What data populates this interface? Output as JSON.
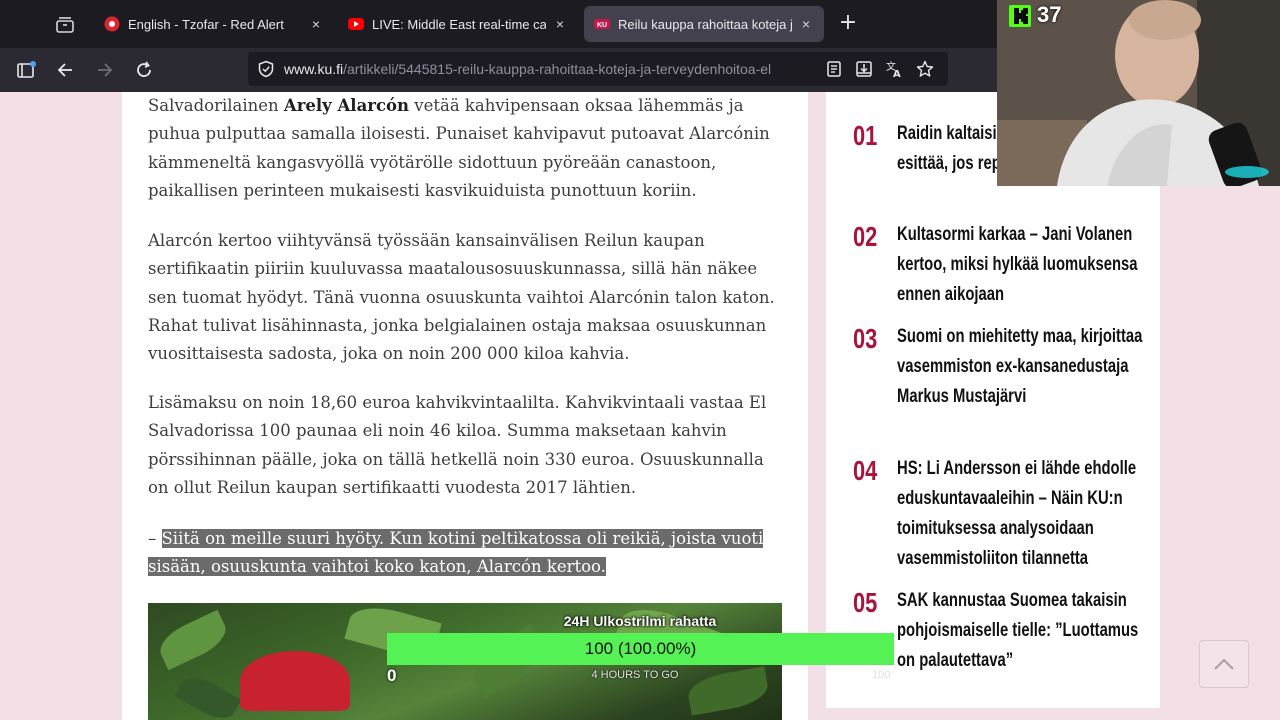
{
  "browser": {
    "tabs": [
      {
        "title": "English - Tzofar - Red Alert",
        "close": "×"
      },
      {
        "title": "LIVE: Middle East real-time cam",
        "close": "×"
      },
      {
        "title": "Reilu kauppa rahoittaa koteja ja",
        "close": "×"
      }
    ],
    "new_tab": "+",
    "url_host": "www.ku.fi",
    "url_path": "/artikkeli/5445815-reilu-kauppa-rahoittaa-koteja-ja-terveydenhoitoa-el"
  },
  "article": {
    "p1_before": "Salvadorilainen ",
    "p1_name": "Arely Alarcón",
    "p1_after": " vetää kahvipensaan oksaa lähemmäs ja puhua pulputtaa samalla iloisesti. Punaiset kahvipavut putoavat Alarcónin kämmeneltä kangasvyöllä vyötärölle sidottuun pyöreään canastoon, paikallisen perinteen mukaisesti kasvikuiduista punottuun koriin.",
    "p2": "Alarcón kertoo viihtyvänsä työssään kansainvälisen Reilun kaupan sertifikaatin piiriin kuuluvassa maatalousosuuskunnassa, sillä hän näkee sen tuomat hyödyt. Tänä vuonna osuuskunta vaihtoi Alarcónin talon katon. Rahat tulivat lisähinnasta, jonka belgialainen ostaja maksaa osuuskunnan vuosittaisesta sadosta, joka on noin 200 000 kiloa kahvia.",
    "p3": "Lisämaksu on noin 18,60 euroa kahvikvintaalilta. Kahvikvintaali vastaa El Salvadorissa 100 paunaa eli noin 46 kiloa. Summa maksetaan kahvin pörssihinnan päälle, joka on tällä hetkellä noin 330 euroa. Osuuskunnalla on ollut Reilun kaupan sertifikaatti vuodesta 2017 lähtien.",
    "quote_dash": "–",
    "quote": "Siitä on meille suuri hyöty. Kun kotini peltikatossa oli reikiä, joista vuoti sisään, osuuskunta vaihtoi koko katon, Alarcón kertoo."
  },
  "sidebar": {
    "items": [
      {
        "num": "01",
        "title": "Raidin kaltaisia sarjoja ei voisi enää esittää, jos repisivät pelihousunsa"
      },
      {
        "num": "02",
        "title": "Kultasormi karkaa – Jani Volanen kertoo, miksi hylkää luomuksensa ennen aikojaan"
      },
      {
        "num": "03",
        "title": "Suomi on miehitetty maa, kirjoittaa vasemmiston ex-kansanedustaja Markus Mustajärvi"
      },
      {
        "num": "04",
        "title": "HS: Li Andersson ei lähde ehdolle eduskuntavaaleihin – Näin KU:n toimituksessa analysoidaan vasemmistoliiton tilannetta"
      },
      {
        "num": "05",
        "title": "SAK kannustaa Suomea takaisin pohjoismaiselle tielle: ”Luottamus on palautettava”"
      }
    ]
  },
  "stream_overlay": {
    "viewer_count": "37",
    "goal_title": "24H Ulkostrilmi rahatta",
    "goal_text": "100 (100.00%)",
    "goal_progress": 1.0,
    "goal_min": "0",
    "goal_max": "100",
    "goal_time": "4 HOURS TO GO"
  }
}
